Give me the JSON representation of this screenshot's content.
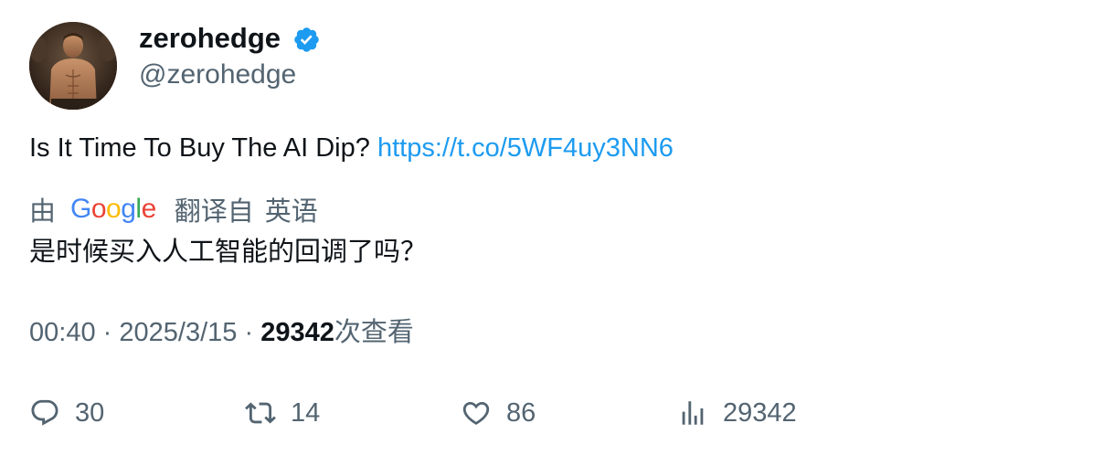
{
  "author": {
    "display_name": "zerohedge",
    "handle": "@zerohedge",
    "verified": true
  },
  "tweet": {
    "text": "Is It Time To Buy The AI Dip?",
    "link": "https://t.co/5WF4uy3NN6"
  },
  "translation": {
    "by_label": "由",
    "provider": "Google",
    "from_label": "翻译自",
    "source_language": "英语",
    "translated_text": "是时候买入人工智能的回调了吗？"
  },
  "meta": {
    "time": "00:40",
    "separator": "·",
    "date": "2025/3/15",
    "views_count": "29342",
    "views_label": "次查看"
  },
  "actions": {
    "replies": "30",
    "retweets": "14",
    "likes": "86",
    "views": "29342"
  },
  "colors": {
    "link": "#1d9bf0",
    "secondary_text": "#536471",
    "primary_text": "#0f1419",
    "verified": "#1d9bf0"
  }
}
